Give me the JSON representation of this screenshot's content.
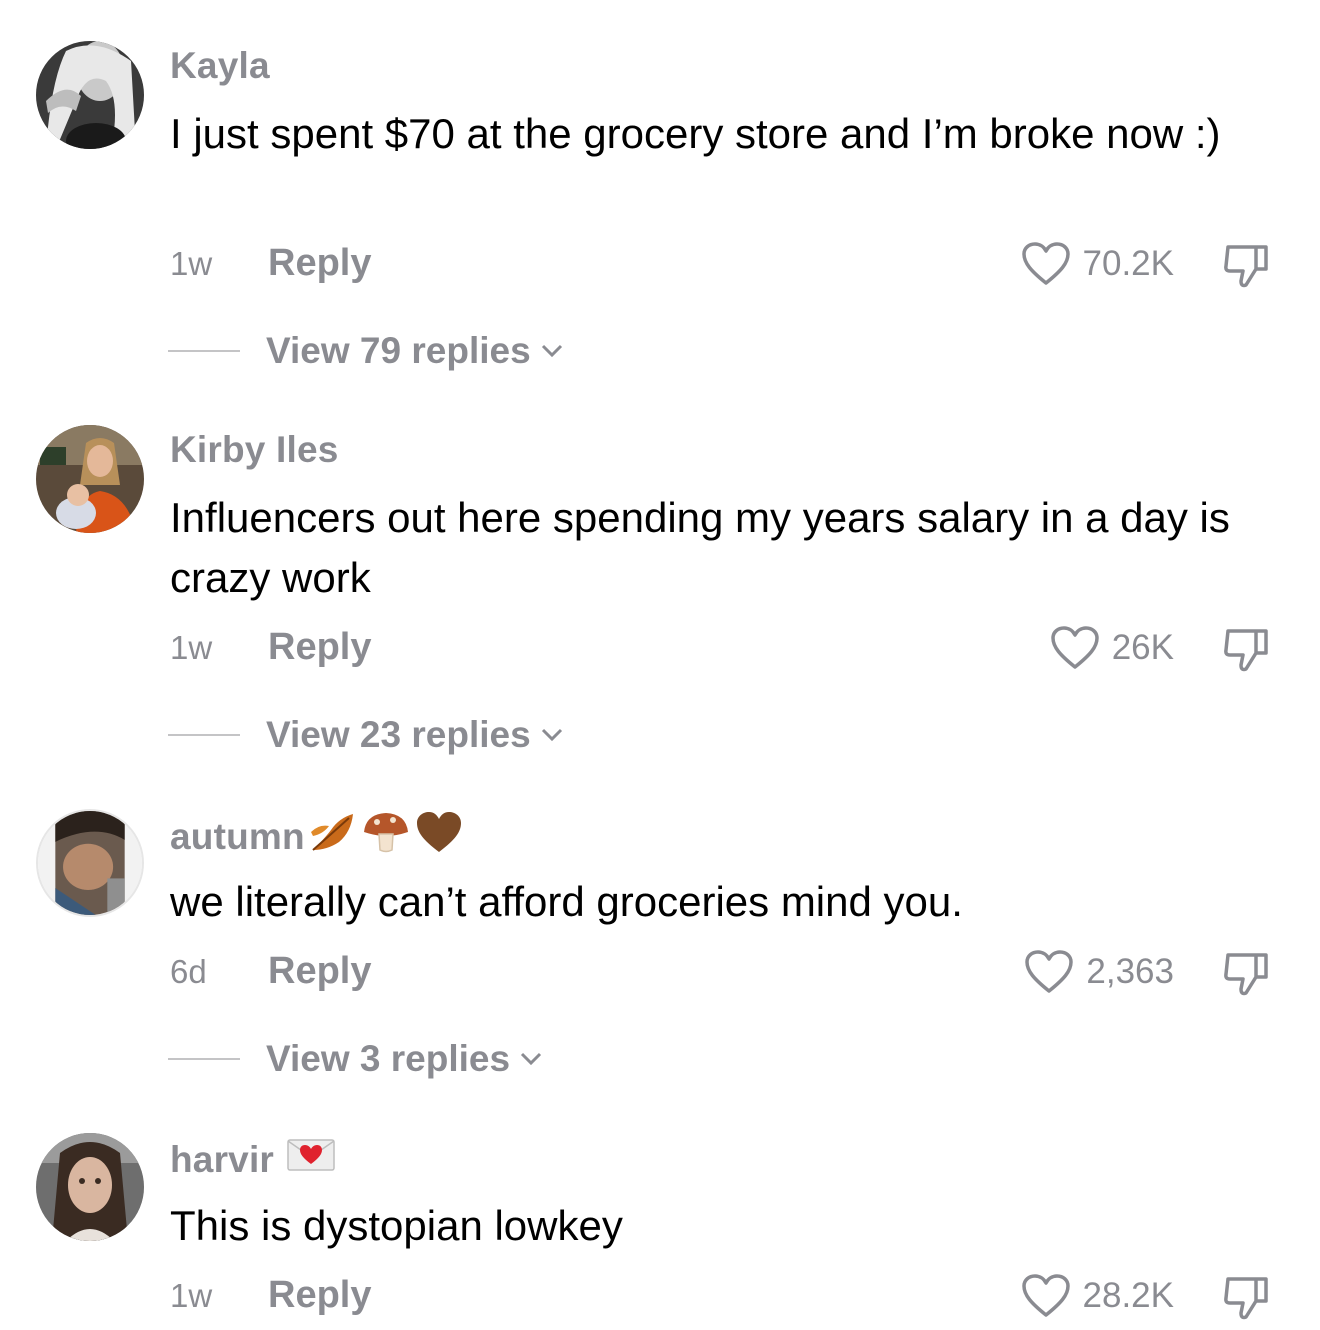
{
  "comments": [
    {
      "username": "Kayla",
      "text": "I just spent $70 at the grocery store and I’m broke now :)",
      "time": "1w",
      "reply_label": "Reply",
      "likes": "70.2K",
      "view_replies": "View 79 replies",
      "avatar": "avatar-photo-grayscale"
    },
    {
      "username": "Kirby Iles",
      "text": "Influencers out here spending my years salary in a day is crazy work",
      "time": "1w",
      "reply_label": "Reply",
      "likes": "26K",
      "view_replies": "View 23 replies",
      "avatar": "avatar-photo-with-baby"
    },
    {
      "username": "autumn",
      "username_emoji": [
        "fallen-leaf-emoji",
        "mushroom-emoji",
        "brown-heart-emoji"
      ],
      "text": "we literally can’t afford groceries mind you.",
      "time": "6d",
      "reply_label": "Reply",
      "likes": "2,363",
      "view_replies": "View 3 replies",
      "avatar": "avatar-photo-selfie"
    },
    {
      "username": "harvir",
      "username_emoji": [
        "love-letter-emoji"
      ],
      "text": "This is dystopian lowkey",
      "time": "1w",
      "reply_label": "Reply",
      "likes": "28.2K",
      "avatar": "avatar-photo-portrait"
    }
  ],
  "colors": {
    "secondary_text": "#8a8b91",
    "primary_text": "#000000",
    "background": "#ffffff"
  }
}
